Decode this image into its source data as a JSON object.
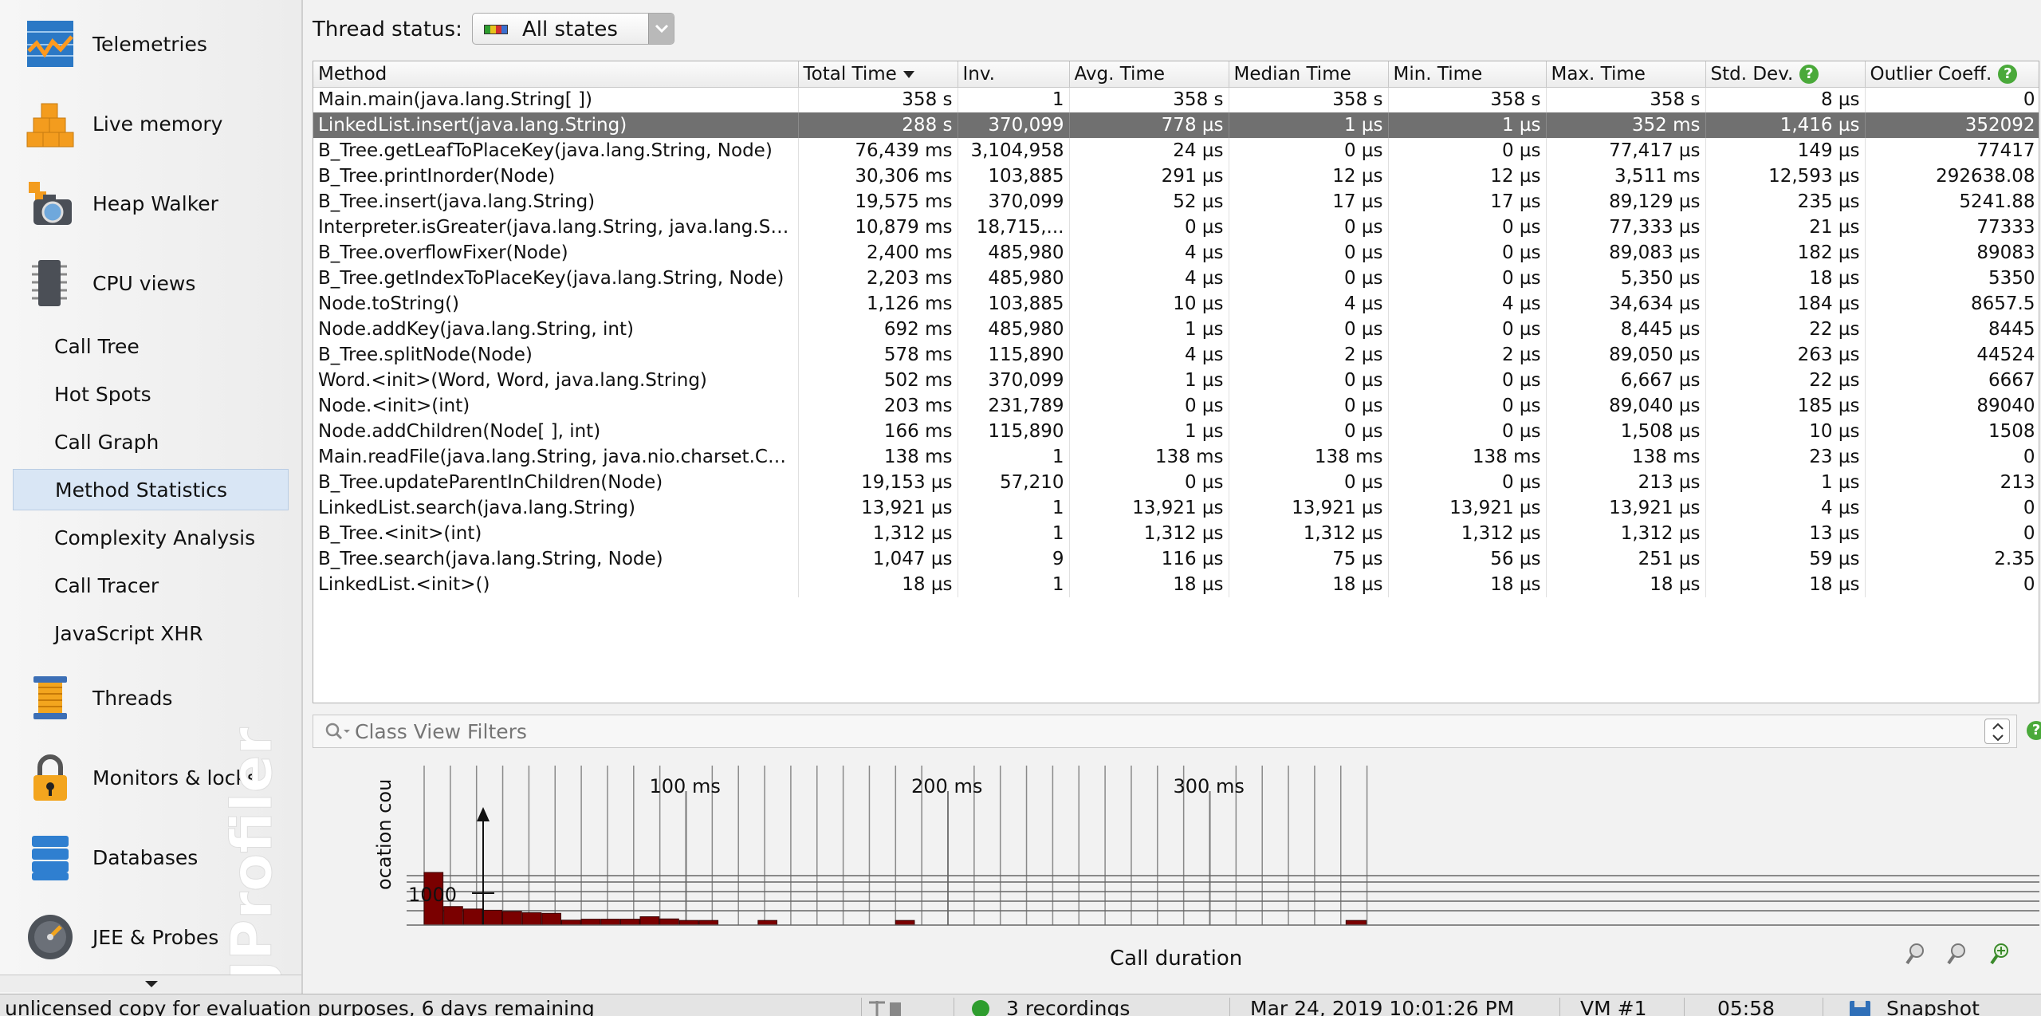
{
  "sidebar": {
    "sections": [
      {
        "label": "Telemetries",
        "icon": "telemetries-icon"
      },
      {
        "label": "Live memory",
        "icon": "live-memory-icon"
      },
      {
        "label": "Heap Walker",
        "icon": "heap-walker-icon"
      },
      {
        "label": "CPU views",
        "icon": "cpu-views-icon"
      }
    ],
    "cpu_items": [
      "Call Tree",
      "Hot Spots",
      "Call Graph",
      "Method Statistics",
      "Complexity Analysis",
      "Call Tracer",
      "JavaScript XHR"
    ],
    "selected_item": "Method Statistics",
    "more_sections": [
      {
        "label": "Threads",
        "icon": "threads-icon"
      },
      {
        "label": "Monitors & locks",
        "icon": "monitors-locks-icon"
      },
      {
        "label": "Databases",
        "icon": "databases-icon"
      },
      {
        "label": "JEE & Probes",
        "icon": "jee-probes-icon"
      }
    ],
    "watermark": "JProfiler"
  },
  "thread_status": {
    "label": "Thread status:",
    "value": "All states"
  },
  "table": {
    "columns": [
      "Method",
      "Total Time",
      "Inv.",
      "Avg. Time",
      "Median Time",
      "Min. Time",
      "Max. Time",
      "Std. Dev.",
      "Outlier Coeff."
    ],
    "sorted_column": "Total Time",
    "selected_row": 1,
    "rows": [
      [
        "Main.main(java.lang.String[ ])",
        "358 s",
        "1",
        "358 s",
        "358 s",
        "358 s",
        "358 s",
        "8 µs",
        "0"
      ],
      [
        "LinkedList.insert(java.lang.String)",
        "288 s",
        "370,099",
        "778 µs",
        "1 µs",
        "1 µs",
        "352 ms",
        "1,416 µs",
        "352092"
      ],
      [
        "B_Tree.getLeafToPlaceKey(java.lang.String, Node)",
        "76,439 ms",
        "3,104,958",
        "24 µs",
        "0 µs",
        "0 µs",
        "77,417 µs",
        "149 µs",
        "77417"
      ],
      [
        "B_Tree.printInorder(Node)",
        "30,306 ms",
        "103,885",
        "291 µs",
        "12 µs",
        "12 µs",
        "3,511 ms",
        "12,593 µs",
        "292638.08"
      ],
      [
        "B_Tree.insert(java.lang.String)",
        "19,575 ms",
        "370,099",
        "52 µs",
        "17 µs",
        "17 µs",
        "89,129 µs",
        "235 µs",
        "5241.88"
      ],
      [
        "Interpreter.isGreater(java.lang.String, java.lang.St...",
        "10,879 ms",
        "18,715,...",
        "0 µs",
        "0 µs",
        "0 µs",
        "77,333 µs",
        "21 µs",
        "77333"
      ],
      [
        "B_Tree.overflowFixer(Node)",
        "2,400 ms",
        "485,980",
        "4 µs",
        "0 µs",
        "0 µs",
        "89,083 µs",
        "182 µs",
        "89083"
      ],
      [
        "B_Tree.getIndexToPlaceKey(java.lang.String, Node)",
        "2,203 ms",
        "485,980",
        "4 µs",
        "0 µs",
        "0 µs",
        "5,350 µs",
        "18 µs",
        "5350"
      ],
      [
        "Node.toString()",
        "1,126 ms",
        "103,885",
        "10 µs",
        "4 µs",
        "4 µs",
        "34,634 µs",
        "184 µs",
        "8657.5"
      ],
      [
        "Node.addKey(java.lang.String, int)",
        "692 ms",
        "485,980",
        "1 µs",
        "0 µs",
        "0 µs",
        "8,445 µs",
        "22 µs",
        "8445"
      ],
      [
        "B_Tree.splitNode(Node)",
        "578 ms",
        "115,890",
        "4 µs",
        "2 µs",
        "2 µs",
        "89,050 µs",
        "263 µs",
        "44524"
      ],
      [
        "Word.<init>(Word, Word, java.lang.String)",
        "502 ms",
        "370,099",
        "1 µs",
        "0 µs",
        "0 µs",
        "6,667 µs",
        "22 µs",
        "6667"
      ],
      [
        "Node.<init>(int)",
        "203 ms",
        "231,789",
        "0 µs",
        "0 µs",
        "0 µs",
        "89,040 µs",
        "185 µs",
        "89040"
      ],
      [
        "Node.addChildren(Node[ ], int)",
        "166 ms",
        "115,890",
        "1 µs",
        "0 µs",
        "0 µs",
        "1,508 µs",
        "10 µs",
        "1508"
      ],
      [
        "Main.readFile(java.lang.String, java.nio.charset.Ch...",
        "138 ms",
        "1",
        "138 ms",
        "138 ms",
        "138 ms",
        "138 ms",
        "23 µs",
        "0"
      ],
      [
        "B_Tree.updateParentInChildren(Node)",
        "19,153 µs",
        "57,210",
        "0 µs",
        "0 µs",
        "0 µs",
        "213 µs",
        "1 µs",
        "213"
      ],
      [
        "LinkedList.search(java.lang.String)",
        "13,921 µs",
        "1",
        "13,921 µs",
        "13,921 µs",
        "13,921 µs",
        "13,921 µs",
        "4 µs",
        "0"
      ],
      [
        "B_Tree.<init>(int)",
        "1,312 µs",
        "1",
        "1,312 µs",
        "1,312 µs",
        "1,312 µs",
        "1,312 µs",
        "13 µs",
        "0"
      ],
      [
        "B_Tree.search(java.lang.String, Node)",
        "1,047 µs",
        "9",
        "116 µs",
        "75 µs",
        "56 µs",
        "251 µs",
        "59 µs",
        "2.35"
      ],
      [
        "LinkedList.<init>()",
        "18 µs",
        "1",
        "18 µs",
        "18 µs",
        "18 µs",
        "18 µs",
        "18 µs",
        "0"
      ]
    ]
  },
  "filter": {
    "placeholder": "Class View Filters"
  },
  "histogram": {
    "x_tick_labels": [
      "100 ms",
      "200 ms",
      "300 ms"
    ],
    "y_axis_label_visible": "ocation cou",
    "y_tick_label": "1000",
    "x_axis_label": "Call duration",
    "bar_color": "#7a0000"
  },
  "chart_data": {
    "type": "bar",
    "title": "",
    "xlabel": "Call duration",
    "ylabel": "ocation cou",
    "x_unit": "ms",
    "x_ticks": [
      100,
      200,
      300
    ],
    "y_ticks": [
      1000
    ],
    "bins": [
      {
        "start_ms": 0,
        "end_ms": 7.5,
        "count": 1290
      },
      {
        "start_ms": 7.5,
        "end_ms": 15,
        "count": 600
      },
      {
        "start_ms": 15,
        "end_ms": 22.5,
        "count": 520
      },
      {
        "start_ms": 22.5,
        "end_ms": 30,
        "count": 480
      },
      {
        "start_ms": 30,
        "end_ms": 37.5,
        "count": 440
      },
      {
        "start_ms": 37.5,
        "end_ms": 45,
        "count": 400
      },
      {
        "start_ms": 45,
        "end_ms": 52.5,
        "count": 380
      },
      {
        "start_ms": 52.5,
        "end_ms": 60,
        "count": 160
      },
      {
        "start_ms": 60,
        "end_ms": 67.5,
        "count": 190
      },
      {
        "start_ms": 67.5,
        "end_ms": 75,
        "count": 190
      },
      {
        "start_ms": 75,
        "end_ms": 82.5,
        "count": 190
      },
      {
        "start_ms": 82.5,
        "end_ms": 90,
        "count": 270
      },
      {
        "start_ms": 90,
        "end_ms": 97.5,
        "count": 200
      },
      {
        "start_ms": 97.5,
        "end_ms": 105,
        "count": 150
      },
      {
        "start_ms": 105,
        "end_ms": 112.5,
        "count": 150
      },
      {
        "start_ms": 127.5,
        "end_ms": 135,
        "count": 150
      },
      {
        "start_ms": 180,
        "end_ms": 187.5,
        "count": 150
      },
      {
        "start_ms": 352,
        "end_ms": 360,
        "count": 150
      }
    ]
  },
  "statusbar": {
    "license": "unlicensed copy for evaluation purposes, 6 days remaining",
    "recordings": "3 recordings",
    "timestamp": "Mar 24, 2019 10:01:26 PM",
    "vm": "VM #1",
    "elapsed": "05:58",
    "snapshot": "Snapshot",
    "recording_status_color": "#2e9d2e"
  }
}
